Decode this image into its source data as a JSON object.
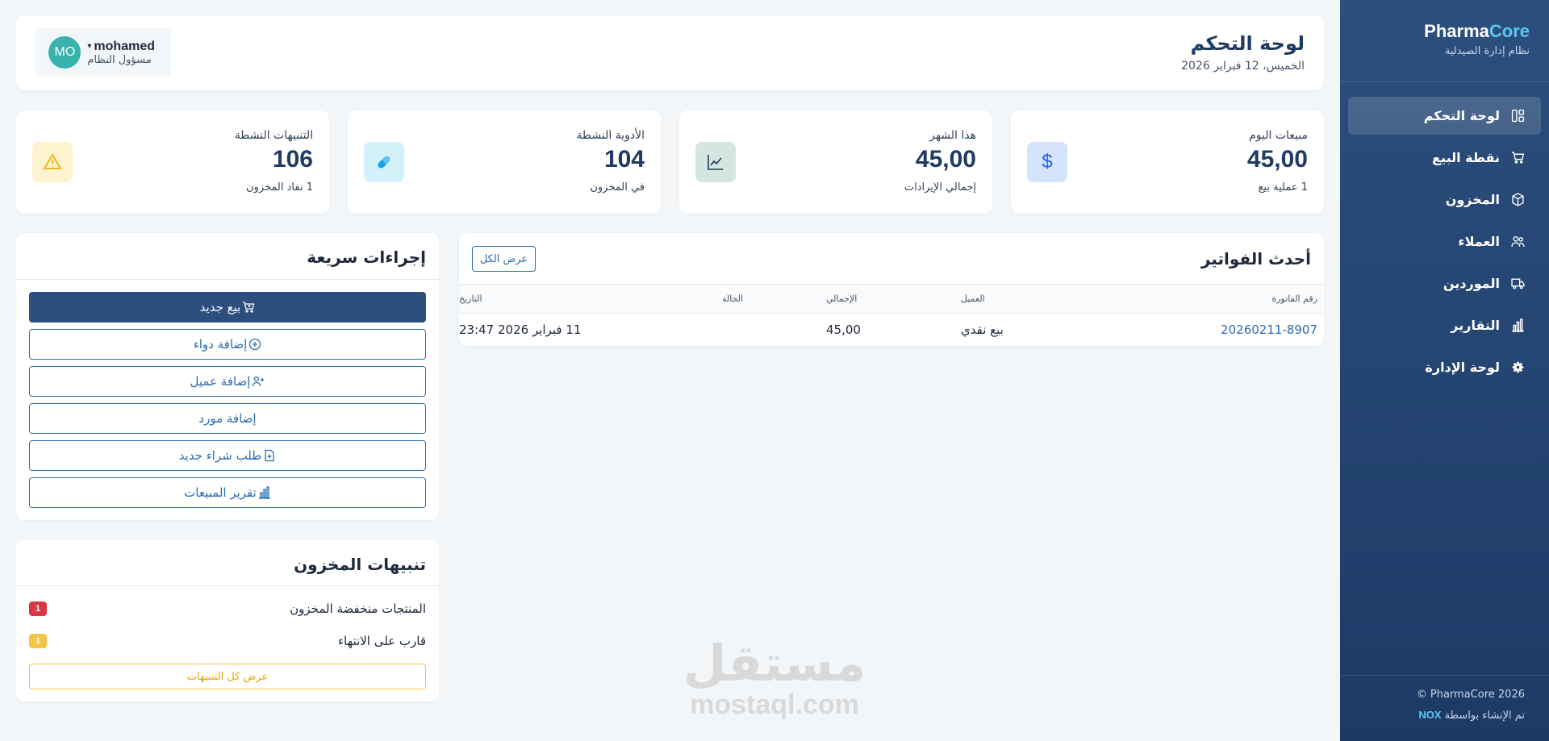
{
  "brand": {
    "name_part1": "Pharma",
    "name_part2": "Core",
    "subtitle": "نظام إدارة الصيدلية"
  },
  "nav": {
    "items": [
      {
        "label": "لوحة التحكم",
        "icon": "dashboard-icon",
        "active": true
      },
      {
        "label": "نقطة البيع",
        "icon": "cart-icon"
      },
      {
        "label": "المخزون",
        "icon": "box-icon"
      },
      {
        "label": "العملاء",
        "icon": "users-icon"
      },
      {
        "label": "الموردين",
        "icon": "truck-icon"
      },
      {
        "label": "التقارير",
        "icon": "bar-chart-icon"
      },
      {
        "label": "لوحة الإدارة",
        "icon": "gear-icon"
      }
    ]
  },
  "footer": {
    "copyright": "PharmaCore 2026",
    "made_by_prefix": "تم الإنشاء بواسطة",
    "made_by_name": "NOX"
  },
  "header": {
    "title": "لوحة التحكم",
    "date": "الخميس، 12 فبراير 2026"
  },
  "user": {
    "initials": "MO",
    "name": "mohamed",
    "role": "مسؤول النظام"
  },
  "stats": [
    {
      "label": "مبيعات اليوم",
      "value": "45,00",
      "sub": "1 عملية بيع",
      "icon": "dollar-icon",
      "icon_bg": "#d6e4fb",
      "icon_color": "#2563eb"
    },
    {
      "label": "هذا الشهر",
      "value": "45,00",
      "sub": "إجمالي الإيرادات",
      "icon": "trend-icon",
      "icon_bg": "#d4e6df",
      "icon_color": "#1f3b64"
    },
    {
      "label": "الأدوية النشطة",
      "value": "104",
      "sub": "في المخزون",
      "icon": "pill-icon",
      "icon_bg": "#d4f0f8",
      "icon_color": "#0ea5e9"
    },
    {
      "label": "التنبيهات النشطة",
      "value": "106",
      "sub": "1 نفاد المخزون",
      "icon": "warning-icon",
      "icon_bg": "#fcf3cf",
      "icon_color": "#eab308"
    }
  ],
  "invoices": {
    "title": "أحدث الفواتير",
    "view_all": "عرض الكل",
    "columns": [
      "رقم الفاتورة",
      "العميل",
      "الإجمالي",
      "الحالة",
      "التاريخ"
    ],
    "rows": [
      {
        "number": "20260211-8907",
        "customer": "بيع نقدي",
        "total": "45,00",
        "status": "",
        "date": "11 فبراير 2026 23:47"
      }
    ]
  },
  "quick_actions": {
    "title": "إجراءات سريعة",
    "buttons": [
      {
        "label": "بيع جديد",
        "icon": "cart-plus-icon"
      },
      {
        "label": "إضافة دواء",
        "icon": "plus-circle-icon"
      },
      {
        "label": "إضافة عميل",
        "icon": "user-plus-icon"
      },
      {
        "label": "إضافة مورد",
        "icon": ""
      },
      {
        "label": "طلب شراء جديد",
        "icon": "file-plus-icon"
      },
      {
        "label": "تقرير المبيعات",
        "icon": "bar-chart-icon"
      }
    ]
  },
  "stock_alerts": {
    "title": "تنبيهات المخزون",
    "items": [
      {
        "label": "المنتجات منخفضة المخزون",
        "count": "1",
        "color": "#dc3545"
      },
      {
        "label": "قارب على الانتهاء",
        "count": "1",
        "color": "#f6c343"
      }
    ],
    "view_all": "عرض كل التنبيهات"
  },
  "watermark": {
    "arabic": "مستقل",
    "latin": "mostaql.com"
  }
}
